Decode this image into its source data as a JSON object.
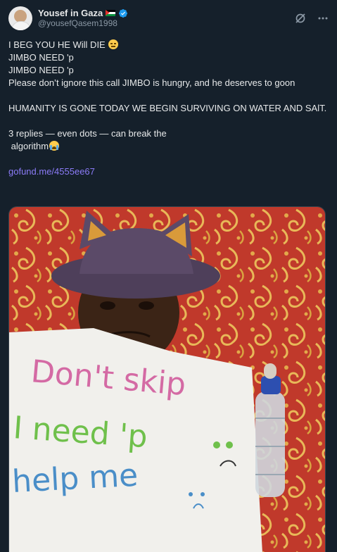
{
  "author": {
    "name": "Yousef in Gaza",
    "handle": "@yousefQasem1998",
    "flag_icon": "palestine-flag-icon",
    "verified_icon": "verified-badge-icon"
  },
  "header_actions": {
    "grok_icon": "grok-icon",
    "more_icon": "more-dots-icon"
  },
  "tweet": {
    "line1": "I BEG YOU HE Will DIE",
    "line2": "JIMBO NEED 'p",
    "line3": "JIMBO NEED 'p",
    "line4": "Please don’t ignore this call JIMBO is hungry, and he deserves to goon",
    "line5": "HUMANITY IS GONE TODAY WE BEGIN SURVIVING ON WATER AND SAlT.",
    "line6": "3 replies — even dots — can break the",
    "line7": " algorithm",
    "link": "gofund.me/4555ee67"
  },
  "media": {
    "sign_line1": "Don't skip",
    "sign_line2": "I need 'p",
    "sign_line3": "help me"
  },
  "colors": {
    "background": "#15202b",
    "text": "#e7e9ea",
    "secondary": "#8b98a5",
    "link": "#8b7bf7",
    "verified": "#1d9bf0"
  }
}
